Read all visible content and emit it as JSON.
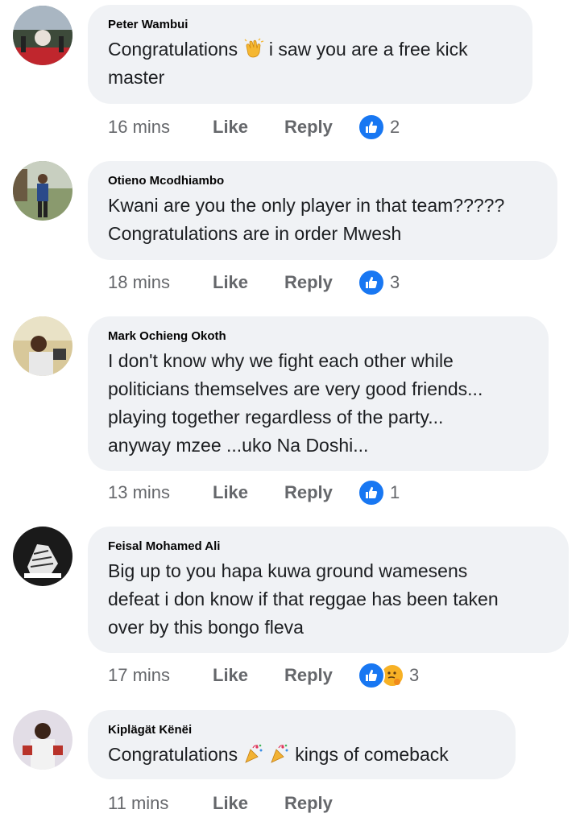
{
  "colors": {
    "bubble": "#f0f2f5",
    "meta_text": "#65676b",
    "like_blue": "#1877f2"
  },
  "actions": {
    "like": "Like",
    "reply": "Reply"
  },
  "comments": [
    {
      "author": "Peter Wambui",
      "text_before": "Congratulations",
      "emoji": "clapping-hands",
      "text_after": "i saw you are a free kick",
      "text_line2": "master",
      "time": "16 mins",
      "reaction_count": "2",
      "reactions": [
        "like"
      ]
    },
    {
      "author": "Otieno Mcodhiambo",
      "line1": "Kwani are you the only player in that team?????",
      "line2": "Congratulations are in order Mwesh",
      "time": "18 mins",
      "reaction_count": "3",
      "reactions": [
        "like"
      ]
    },
    {
      "author": "Mark Ochieng Okoth",
      "line1": "I don't know why we fight each other while",
      "line2": "politicians themselves are very good friends...",
      "line3": "playing together regardless of the party...",
      "line4": "anyway mzee ...uko Na Doshi...",
      "time": "13 mins",
      "reaction_count": "1",
      "reactions": [
        "like"
      ]
    },
    {
      "author": "Feisal Mohamed Ali",
      "line1": "Big up to you hapa kuwa ground wamesens",
      "line2": "defeat i don know if that reggae has been taken",
      "line3": "over by this bongo fleva",
      "time": "17 mins",
      "reaction_count": "3",
      "reactions": [
        "like",
        "haha"
      ]
    },
    {
      "author": "Kiplägät Kënëi",
      "text_before": "Congratulations",
      "emoji": "party-popper",
      "text_after": "kings of comeback",
      "time": "11 mins"
    }
  ]
}
